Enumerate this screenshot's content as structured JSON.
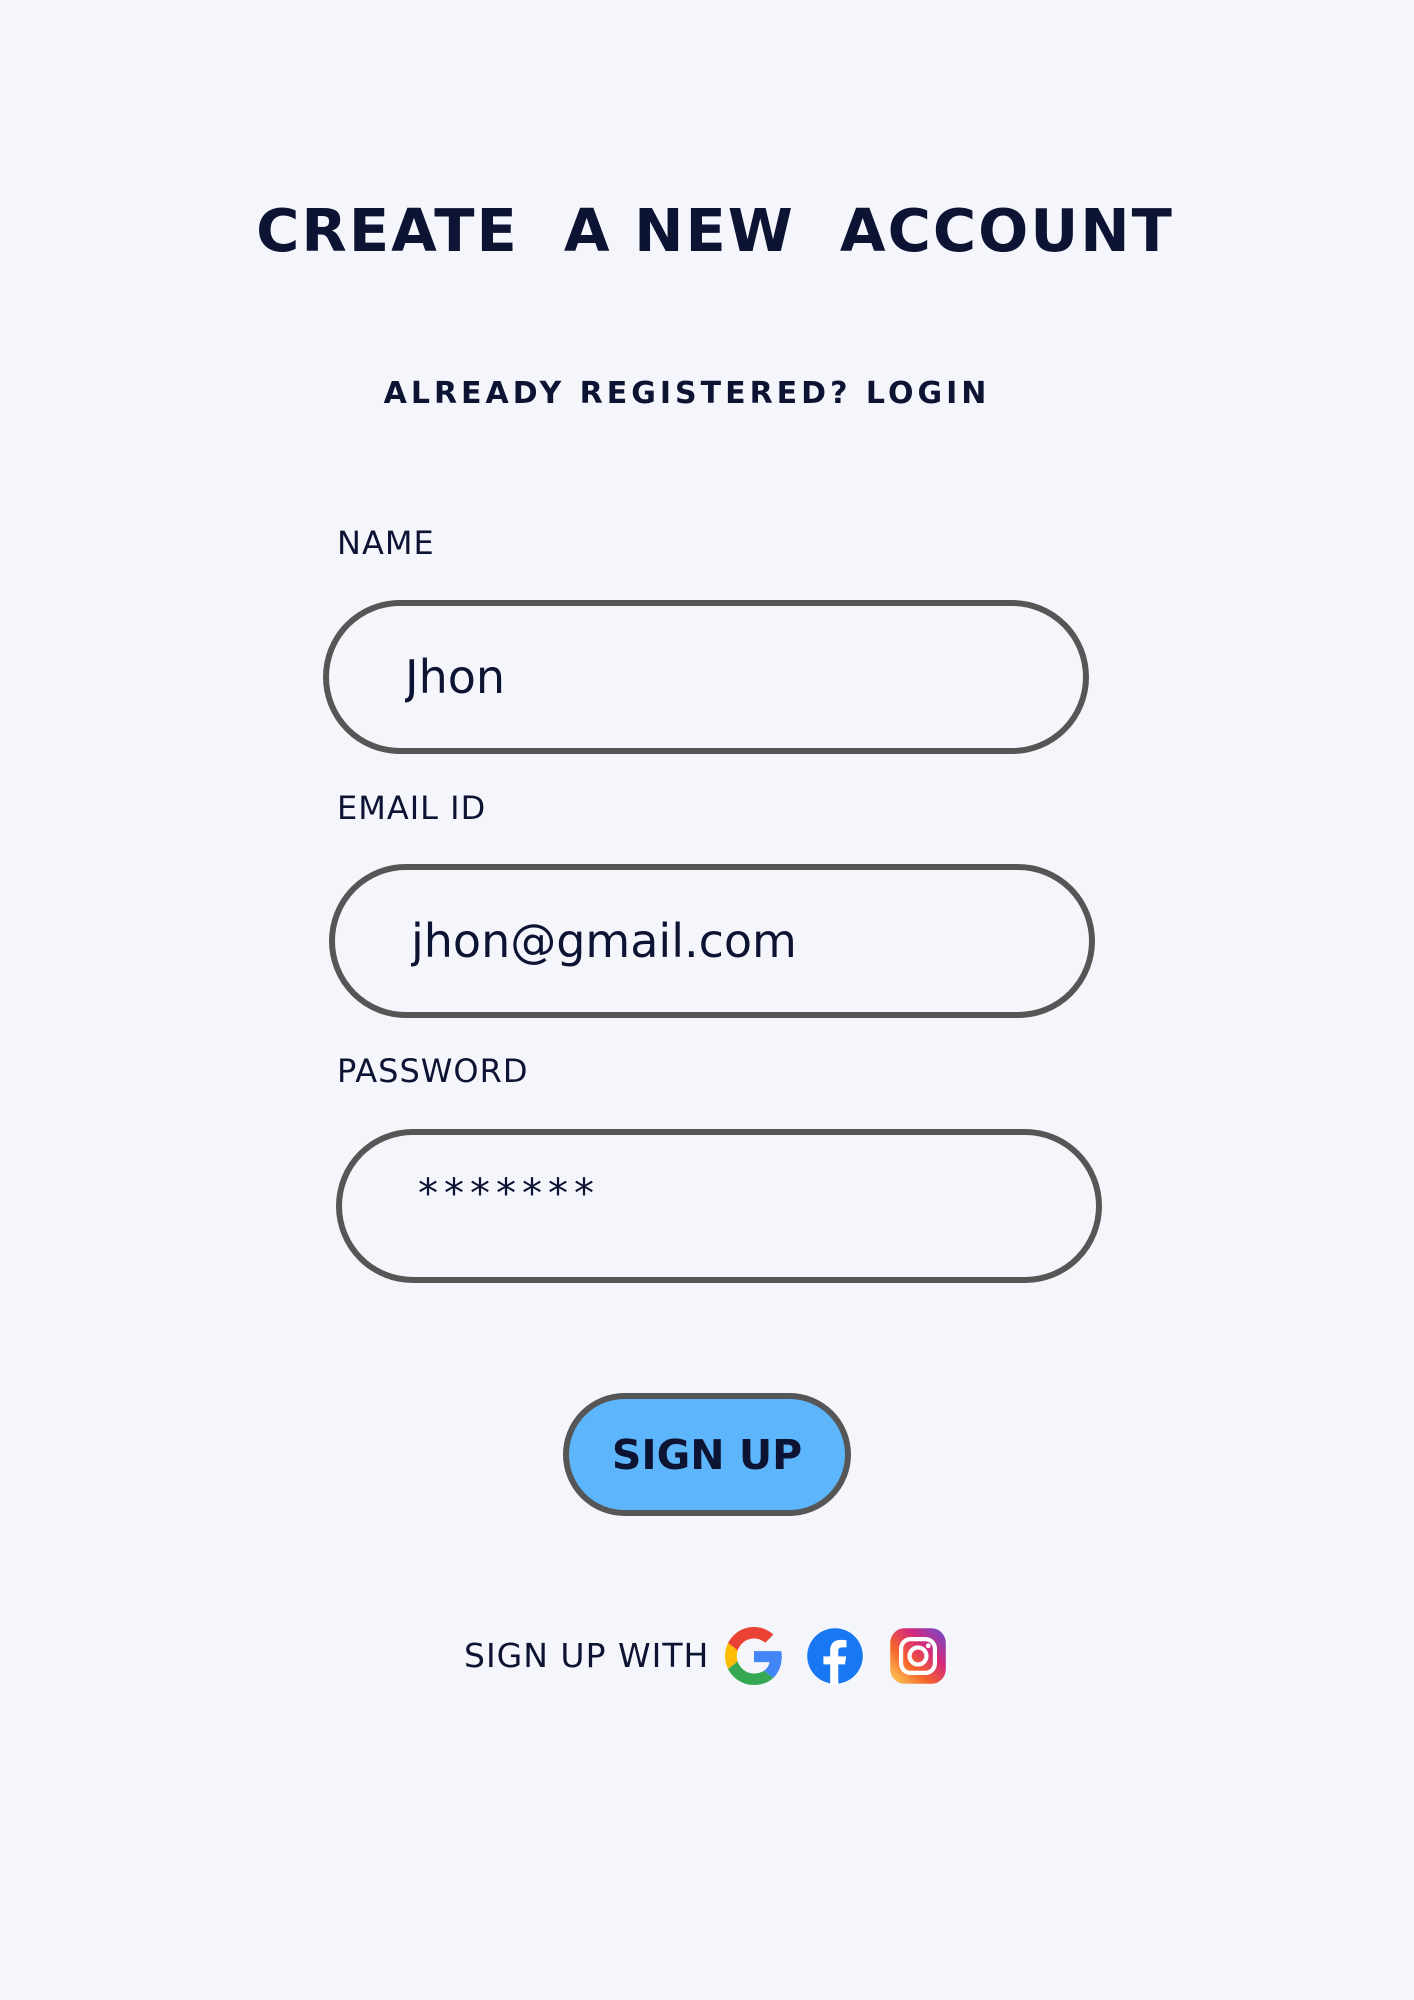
{
  "header": {
    "title": "CREATE  A NEW  ACCOUNT",
    "login_link": "ALREADY REGISTERED? LOGIN"
  },
  "form": {
    "name": {
      "label": "NAME",
      "value": "Jhon"
    },
    "email": {
      "label": "EMAIL ID",
      "value": "jhon@gmail.com"
    },
    "password": {
      "label": "PASSWORD",
      "value": "*******"
    },
    "submit_label": "SIGN UP"
  },
  "social": {
    "label": "SIGN UP WITH",
    "providers": [
      {
        "name": "google-icon"
      },
      {
        "name": "facebook-icon",
        "color": "#1877f2"
      },
      {
        "name": "instagram-icon"
      }
    ]
  }
}
